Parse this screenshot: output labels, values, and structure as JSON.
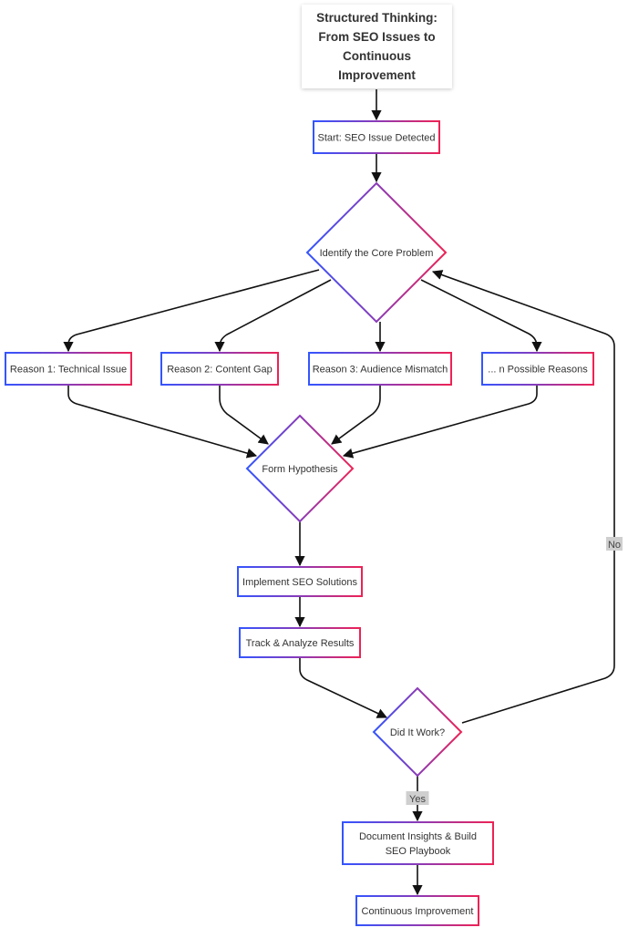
{
  "diagram": {
    "title": "Structured Thinking: From SEO Issues to Continuous Improvement",
    "gradient": {
      "start": "#3355ff",
      "mid": "#8a3bb8",
      "end": "#ee2255"
    },
    "nodes": [
      {
        "id": "start",
        "shape": "rect",
        "lines": [
          "Start: SEO Issue Detected"
        ]
      },
      {
        "id": "identify",
        "shape": "diamond",
        "lines": [
          "Identify the Core Problem"
        ]
      },
      {
        "id": "reason1",
        "shape": "rect",
        "lines": [
          "Reason 1: Technical Issue"
        ]
      },
      {
        "id": "reason2",
        "shape": "rect",
        "lines": [
          "Reason 2: Content Gap"
        ]
      },
      {
        "id": "reason3",
        "shape": "rect",
        "lines": [
          "Reason 3: Audience Mismatch"
        ]
      },
      {
        "id": "reasonN",
        "shape": "rect",
        "lines": [
          "... n Possible Reasons"
        ]
      },
      {
        "id": "hypothesis",
        "shape": "diamond",
        "lines": [
          "Form Hypothesis"
        ]
      },
      {
        "id": "implement",
        "shape": "rect",
        "lines": [
          "Implement SEO Solutions"
        ]
      },
      {
        "id": "track",
        "shape": "rect",
        "lines": [
          "Track & Analyze Results"
        ]
      },
      {
        "id": "decision",
        "shape": "diamond",
        "lines": [
          "Did It Work?"
        ]
      },
      {
        "id": "document",
        "shape": "rect",
        "lines": [
          "Document Insights & Build",
          "SEO Playbook"
        ]
      },
      {
        "id": "continuous",
        "shape": "rect",
        "lines": [
          "Continuous Improvement"
        ]
      }
    ],
    "edges": [
      {
        "from": "title",
        "to": "start",
        "label": ""
      },
      {
        "from": "start",
        "to": "identify",
        "label": ""
      },
      {
        "from": "identify",
        "to": "reason1",
        "label": ""
      },
      {
        "from": "identify",
        "to": "reason2",
        "label": ""
      },
      {
        "from": "identify",
        "to": "reason3",
        "label": ""
      },
      {
        "from": "identify",
        "to": "reasonN",
        "label": ""
      },
      {
        "from": "reason1",
        "to": "hypothesis",
        "label": ""
      },
      {
        "from": "reason2",
        "to": "hypothesis",
        "label": ""
      },
      {
        "from": "reason3",
        "to": "hypothesis",
        "label": ""
      },
      {
        "from": "reasonN",
        "to": "hypothesis",
        "label": ""
      },
      {
        "from": "hypothesis",
        "to": "implement",
        "label": ""
      },
      {
        "from": "implement",
        "to": "track",
        "label": ""
      },
      {
        "from": "track",
        "to": "decision",
        "label": ""
      },
      {
        "from": "decision",
        "to": "identify",
        "label": "No"
      },
      {
        "from": "decision",
        "to": "document",
        "label": "Yes"
      },
      {
        "from": "document",
        "to": "continuous",
        "label": ""
      }
    ]
  }
}
